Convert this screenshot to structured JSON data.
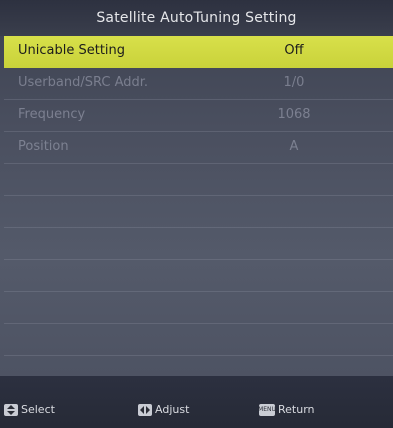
{
  "header": {
    "title": "Satellite AutoTuning Setting"
  },
  "menu": {
    "items": [
      {
        "label": "Unicable Setting",
        "value": "Off",
        "selected": true
      },
      {
        "label": "Userband/SRC Addr.",
        "value": "1/0",
        "selected": false
      },
      {
        "label": "Frequency",
        "value": "1068",
        "selected": false
      },
      {
        "label": "Position",
        "value": "A",
        "selected": false
      }
    ]
  },
  "footer": {
    "select": {
      "label": "Select",
      "icon": "up-down-arrow-key-icon"
    },
    "adjust": {
      "label": "Adjust",
      "icon": "left-right-arrow-key-icon"
    },
    "return": {
      "label": "Return",
      "icon": "menu-key-icon",
      "key_text": "MENU"
    }
  },
  "colors": {
    "highlight": "#d4dc44",
    "background": "#4a4f5f",
    "header_bg": "#2d3140"
  }
}
